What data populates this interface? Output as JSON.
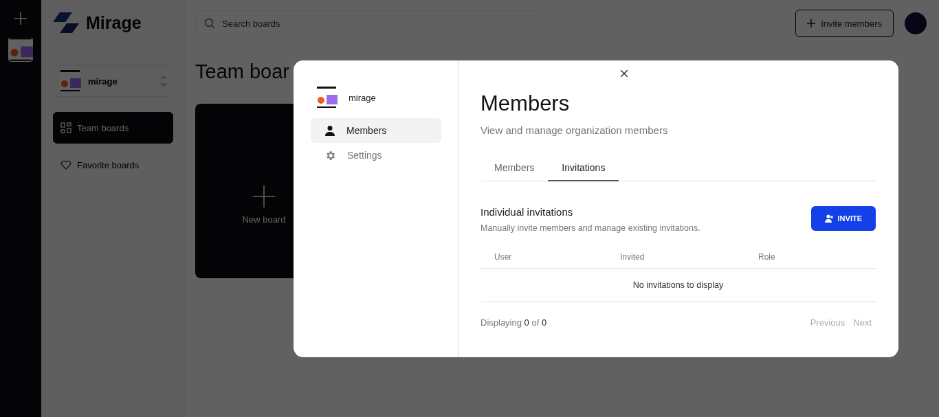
{
  "app": {
    "logo": "Mirage",
    "org": {
      "name": "mirage"
    },
    "nav": [
      {
        "label": "Team boards",
        "kind": "grid",
        "selected": true
      },
      {
        "label": "Favorite boards",
        "kind": "heart",
        "selected": false
      }
    ],
    "search": {
      "placeholder": "Search boards"
    },
    "invite_button": "Invite members",
    "heading": "Team boar",
    "new_board": "New board"
  },
  "modal": {
    "org": {
      "name": "mirage"
    },
    "nav": [
      {
        "label": "Members",
        "kind": "person",
        "selected": true
      },
      {
        "label": "Settings",
        "kind": "gear",
        "selected": false
      }
    ],
    "title": "Members",
    "subtitle": "View and manage organization members",
    "tabs": [
      {
        "label": "Members",
        "selected": false
      },
      {
        "label": "Invitations",
        "selected": true
      }
    ],
    "section": {
      "title": "Individual invitations",
      "description": "Manually invite members and manage existing invitations.",
      "button": "INVITE"
    },
    "table": {
      "columns": [
        "User",
        "Invited",
        "Role"
      ],
      "empty": "No invitations to display"
    },
    "footer": {
      "displaying": "Displaying **0** of **0**",
      "pages": [
        {
          "label": "Previous",
          "disabled": true
        },
        {
          "label": "Next",
          "disabled": true
        }
      ]
    }
  }
}
